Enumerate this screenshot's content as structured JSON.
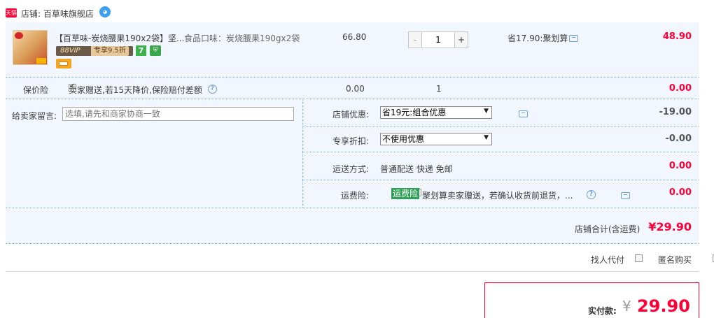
{
  "shop": {
    "badge": "天猫",
    "label": "店铺: 百草味旗舰店"
  },
  "item": {
    "title": "【百草味-炭烧腰果190x2袋】坚...",
    "attr": "食品口味：炭烧腰果190gx2袋",
    "vip_tag": "专享9.5折",
    "vip_logo": "88VIP",
    "badge_7": "7",
    "price": "66.80",
    "qty": "1",
    "minus": "-",
    "plus": "+",
    "discount": "省17.90:聚划算",
    "total": "48.90"
  },
  "insurance": {
    "label": "保价险",
    "text": "卖家赠送,若15天降价,保险赔付差额",
    "price": "0.00",
    "qty": "1",
    "total": "0.00"
  },
  "message": {
    "label": "给卖家留言:",
    "placeholder": "选填,请先和商家协商一致"
  },
  "options": {
    "shop_discount": {
      "label": "店铺优惠:",
      "value": "省19元:组合优惠",
      "amount": "-19.00"
    },
    "exclusive": {
      "label": "专享折扣:",
      "value": "不使用优惠",
      "amount": "-0.00"
    },
    "shipping": {
      "label": "运送方式:",
      "value": "普通配送 快递 免邮",
      "amount": "0.00"
    },
    "freight_ins": {
      "label": "运费险:",
      "tag": "运费险",
      "text": "聚划算卖家赠送，若确认收货前退货，...",
      "amount": "0.00"
    }
  },
  "subtotal": {
    "label": "店铺合计(含运费)",
    "value": "¥29.90"
  },
  "checks": {
    "proxy": "找人代付",
    "anonymous": "匿名购买"
  },
  "payment": {
    "label": "实付款:",
    "currency": "¥",
    "value": "29.90"
  },
  "colors": {
    "accent": "#ff0036",
    "row_bg": "#f2f7ff",
    "link": "#6a9fd8"
  }
}
